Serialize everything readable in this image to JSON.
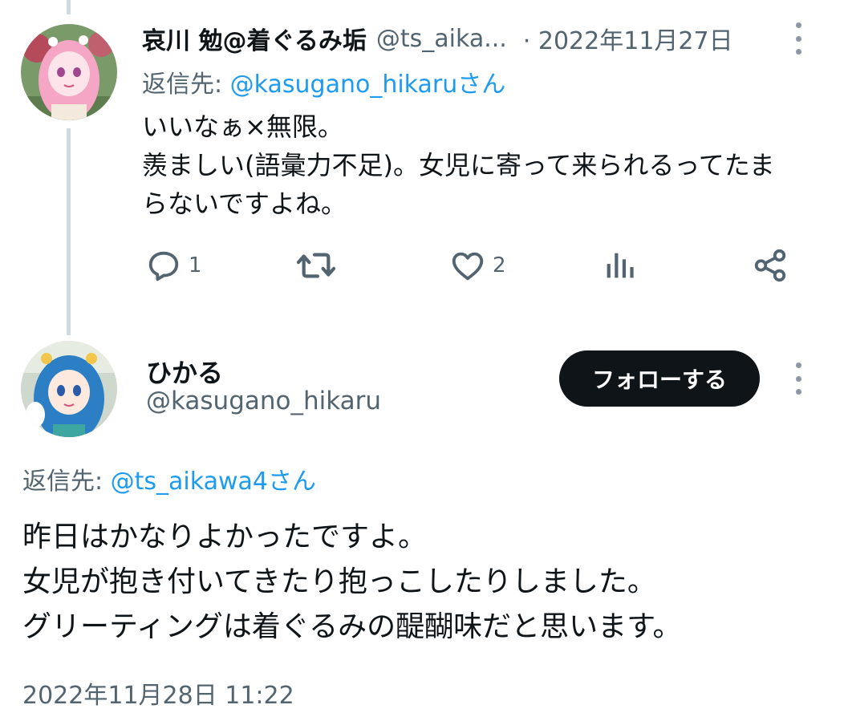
{
  "tweet1": {
    "display_name": "哀川 勉@着ぐるみ垢",
    "handle": "@ts_aika...",
    "date": "· 2022年11月27日",
    "reply_label": "返信先: ",
    "reply_mention": "@kasugano_hikaruさん",
    "body_lines": [
      "いいなぁ×無限。",
      "羨ましい(語彙力不足)。女児に寄って来られるってたま",
      "らないですよね。"
    ],
    "reply_count": "1",
    "like_count": "2",
    "icons": [
      "reply-icon",
      "retweet-icon",
      "like-icon",
      "views-icon",
      "share-icon",
      "more-icon"
    ]
  },
  "tweet2": {
    "display_name": "ひかる",
    "handle": "@kasugano_hikaru",
    "follow_label": "フォローする",
    "reply_label": "返信先: ",
    "reply_mention": "@ts_aikawa4さん",
    "body_lines": [
      "昨日はかなりよかったですよ。",
      "女児が抱き付いてきたり抱っこしたりしました。",
      "グリーティングは着ぐるみの醍醐味だと思います。"
    ],
    "timestamp": "2022年11月28日 11:22"
  },
  "colors": {
    "text_primary": "#0f1419",
    "text_secondary": "#536471",
    "link": "#1d9bf0",
    "thread_line": "#cfd9de",
    "follow_bg": "#0f1419"
  }
}
